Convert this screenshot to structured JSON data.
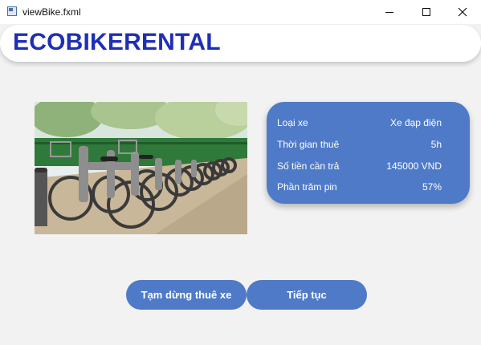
{
  "window": {
    "title": "viewBike.fxml",
    "controls": [
      "minimize-icon",
      "maximize-icon",
      "close-icon"
    ]
  },
  "header": {
    "brand": "ECOBIKERENTAL",
    "brand_color": "#1f2fb5"
  },
  "bike_image": {
    "subject": "row of rental bicycles parked in docking stations"
  },
  "info_card": {
    "accent": "#4f7ac7",
    "rows": [
      {
        "label": "Loại xe",
        "value": "Xe đạp điện"
      },
      {
        "label": "Thời gian thuê",
        "value": "5h"
      },
      {
        "label": "Số tiền cần trả",
        "value": "145000 VND"
      },
      {
        "label": "Phần trăm pin",
        "value": "57%"
      }
    ]
  },
  "actions": {
    "pause_label": "Tạm dừng thuê xe",
    "continue_label": "Tiếp tục"
  }
}
